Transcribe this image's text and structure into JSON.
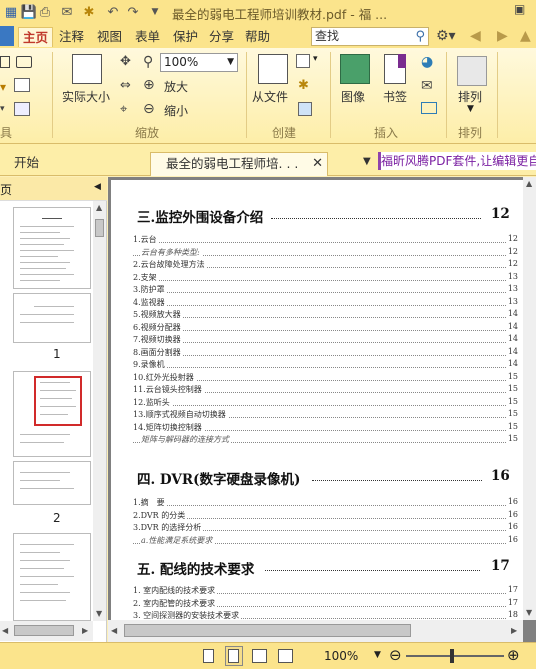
{
  "titlebar": {
    "title": "最全的弱电工程师培训教材.pdf - 福 ..."
  },
  "menu": {
    "tabs": [
      "主页",
      "注释",
      "视图",
      "表单",
      "保护",
      "分享",
      "帮助"
    ],
    "active": "主页",
    "search_placeholder": "查找"
  },
  "ribbon": {
    "actual_size": "实际大小",
    "zoom_value": "100%",
    "zoom_in": "放大",
    "zoom_out": "缩小",
    "from_file": "从文件",
    "image": "图像",
    "bookmark": "书签",
    "arrange": "排列",
    "groups": {
      "tools_partial": "具",
      "zoom": "缩放",
      "create": "创建",
      "insert": "插入",
      "arrange": "排列"
    }
  },
  "tabs": {
    "start": "开始",
    "doc": "最全的弱电工程师培. . .",
    "ad": "福昕风腾PDF套件,让编辑更自由"
  },
  "leftpanel": {
    "header_partial": "页",
    "page_labels": [
      "1",
      "2"
    ]
  },
  "toc": {
    "h3": {
      "title": "三.监控外围设备介绍",
      "page": "12"
    },
    "rows3": [
      {
        "label": "1.云台",
        "page": "12",
        "sub": false
      },
      {
        "label": "云台有多种类型:",
        "page": "12",
        "sub": true
      },
      {
        "label": "2.云台故障处理方法",
        "page": "12",
        "sub": false
      },
      {
        "label": "2.支架",
        "page": "13",
        "sub": false
      },
      {
        "label": "3.防护罩",
        "page": "13",
        "sub": false
      },
      {
        "label": "4.监视器",
        "page": "13",
        "sub": false
      },
      {
        "label": "5.视频放大器",
        "page": "14",
        "sub": false
      },
      {
        "label": "6.视频分配器",
        "page": "14",
        "sub": false
      },
      {
        "label": "7.视频切换器",
        "page": "14",
        "sub": false
      },
      {
        "label": "8.画面分割器",
        "page": "14",
        "sub": false
      },
      {
        "label": "9.录像机",
        "page": "14",
        "sub": false
      },
      {
        "label": "10.红外光投射器",
        "page": "15",
        "sub": false
      },
      {
        "label": "11.云台镜头控制器",
        "page": "15",
        "sub": false
      },
      {
        "label": "12.监听头",
        "page": "15",
        "sub": false
      },
      {
        "label": "13.顺序式视频自动切换器",
        "page": "15",
        "sub": false
      },
      {
        "label": "14.矩阵切换控制器",
        "page": "15",
        "sub": false
      },
      {
        "label": "矩阵与解码器的连接方式",
        "page": "15",
        "sub": true
      }
    ],
    "h4": {
      "title": "四. DVR(数字硬盘录像机)",
      "page": "16"
    },
    "rows4": [
      {
        "label": "1.摘　要",
        "page": "16",
        "sub": false
      },
      {
        "label": "2.DVR 的分类",
        "page": "16",
        "sub": false
      },
      {
        "label": "3.DVR 的选择分析",
        "page": "16",
        "sub": false
      },
      {
        "label": "a.性能满足系统要求",
        "page": "16",
        "sub": true
      }
    ],
    "h5": {
      "title": "五. 配线的技术要求",
      "page": "17"
    },
    "rows5": [
      {
        "label": "1. 室内配线的技术要求",
        "page": "17",
        "sub": false
      },
      {
        "label": "2. 室内配管的技术要求",
        "page": "17",
        "sub": false
      },
      {
        "label": "3. 空间探测器的安装技术要求",
        "page": "18",
        "sub": false
      }
    ]
  },
  "statusbar": {
    "zoom": "100%"
  },
  "colors": {
    "accent": "#c0392b",
    "ribbon_bg": "#fdeea8",
    "title_bg": "#fbe48c"
  }
}
